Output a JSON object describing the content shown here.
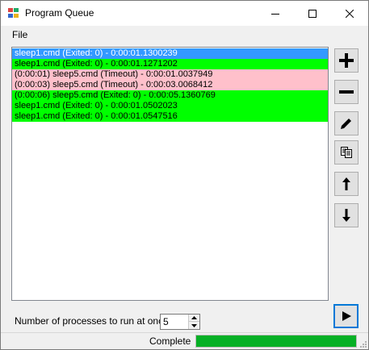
{
  "window": {
    "title": "Program Queue"
  },
  "menu": {
    "file_label": "File"
  },
  "queue": {
    "items": [
      {
        "text": "sleep1.cmd (Exited: 0) - 0:00:01.1300239",
        "state": "selected"
      },
      {
        "text": "sleep1.cmd (Exited: 0) - 0:00:01.1271202",
        "state": "green"
      },
      {
        "text": "(0:00:01) sleep5.cmd (Timeout) - 0:00:01.0037949",
        "state": "pink"
      },
      {
        "text": "(0:00:03) sleep5.cmd (Timeout) - 0:00:03.0068412",
        "state": "pink"
      },
      {
        "text": "(0:00:06) sleep5.cmd (Exited: 0) - 0:00:05.1360769",
        "state": "green"
      },
      {
        "text": "sleep1.cmd (Exited: 0) - 0:00:01.0502023",
        "state": "green"
      },
      {
        "text": "sleep1.cmd (Exited: 0) - 0:00:01.0547516",
        "state": "green"
      }
    ]
  },
  "toolbar": {
    "icons": [
      "plus-icon",
      "minus-icon",
      "pencil-icon",
      "copy-icon",
      "arrow-up-icon",
      "arrow-down-icon",
      "play-icon"
    ]
  },
  "concurrency": {
    "label": "Number of processes to run at once:",
    "value": "5"
  },
  "status": {
    "text": "Complete",
    "progress_percent": 100
  },
  "colors": {
    "selected": "#3399ff",
    "success": "#00ff00",
    "timeout": "#ffc0cb",
    "progress": "#06b025",
    "accent": "#0078d7"
  }
}
